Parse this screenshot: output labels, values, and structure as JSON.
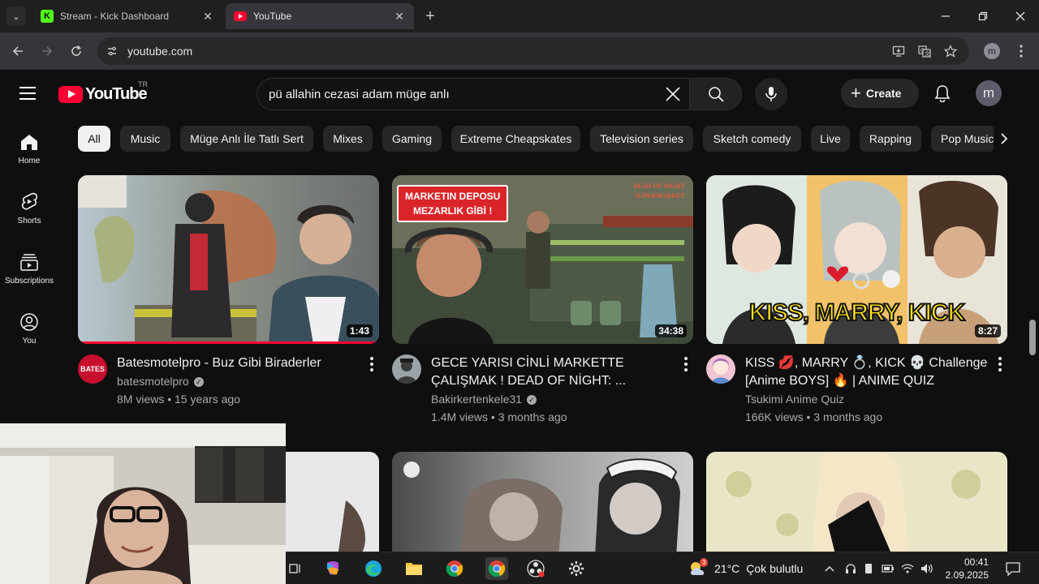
{
  "browser": {
    "tabs": [
      {
        "title": "Stream - Kick Dashboard",
        "favicon": "kick-icon"
      },
      {
        "title": "YouTube",
        "favicon": "youtube-icon"
      }
    ],
    "url": "youtube.com"
  },
  "youtube": {
    "logo_text": "YouTube",
    "country_code": "TR",
    "search_query": "pü allahin cezasi adam müge anlı",
    "create_label": "Create",
    "account_initial": "m",
    "rail": [
      {
        "label": "Home",
        "icon": "home-icon"
      },
      {
        "label": "Shorts",
        "icon": "shorts-icon"
      },
      {
        "label": "Subscriptions",
        "icon": "subscriptions-icon"
      },
      {
        "label": "You",
        "icon": "you-icon"
      }
    ],
    "chips": [
      "All",
      "Music",
      "Müge Anlı İle Tatlı Sert",
      "Mixes",
      "Gaming",
      "Extreme Cheapskates",
      "Television series",
      "Sketch comedy",
      "Live",
      "Rapping",
      "Pop Music"
    ],
    "videos": [
      {
        "title_line1": "Batesmotelpro - Buz Gibi Biraderler",
        "title_line2": "",
        "channel": "batesmotelpro",
        "verified": true,
        "meta": "8M views • 15 years ago",
        "duration": "1:43",
        "avatar_text": "BATES"
      },
      {
        "title_line1": "GECE YARISI CİNLİ MARKETTE",
        "title_line2": "ÇALIŞMAK ! DEAD OF NİGHT: ...",
        "channel": "Bakirkertenkele31",
        "verified": true,
        "meta": "1.4M views • 3 months ago",
        "duration": "34:38",
        "overlay_text_1": "MARKETIN DEPOSU",
        "overlay_text_2": "MEZARLIK GİBİ !",
        "overlay_corner_1": "DEAD OF NIGHT",
        "overlay_corner_2": "SUPERMARKET"
      },
      {
        "title_line1": "KISS 💋, MARRY 💍, KICK 💀 Challenge",
        "title_line2": "[Anime BOYS] 🔥 | ANIME QUIZ",
        "channel": "Tsukimi Anime Quiz",
        "verified": false,
        "meta": "166K views • 3 months ago",
        "duration": "8:27",
        "overlay_text": "KISS, MARRY, KICK"
      }
    ]
  },
  "taskbar": {
    "weather_temp": "21°C",
    "weather_text": "Çok bulutlu",
    "weather_badge": "3",
    "time": "00:41",
    "date": "2.09.2025"
  },
  "colors": {
    "background": "#0f0f0f",
    "youtube_red": "#ff0033",
    "chip_bg": "#272727",
    "kick_green": "#53fc18"
  }
}
